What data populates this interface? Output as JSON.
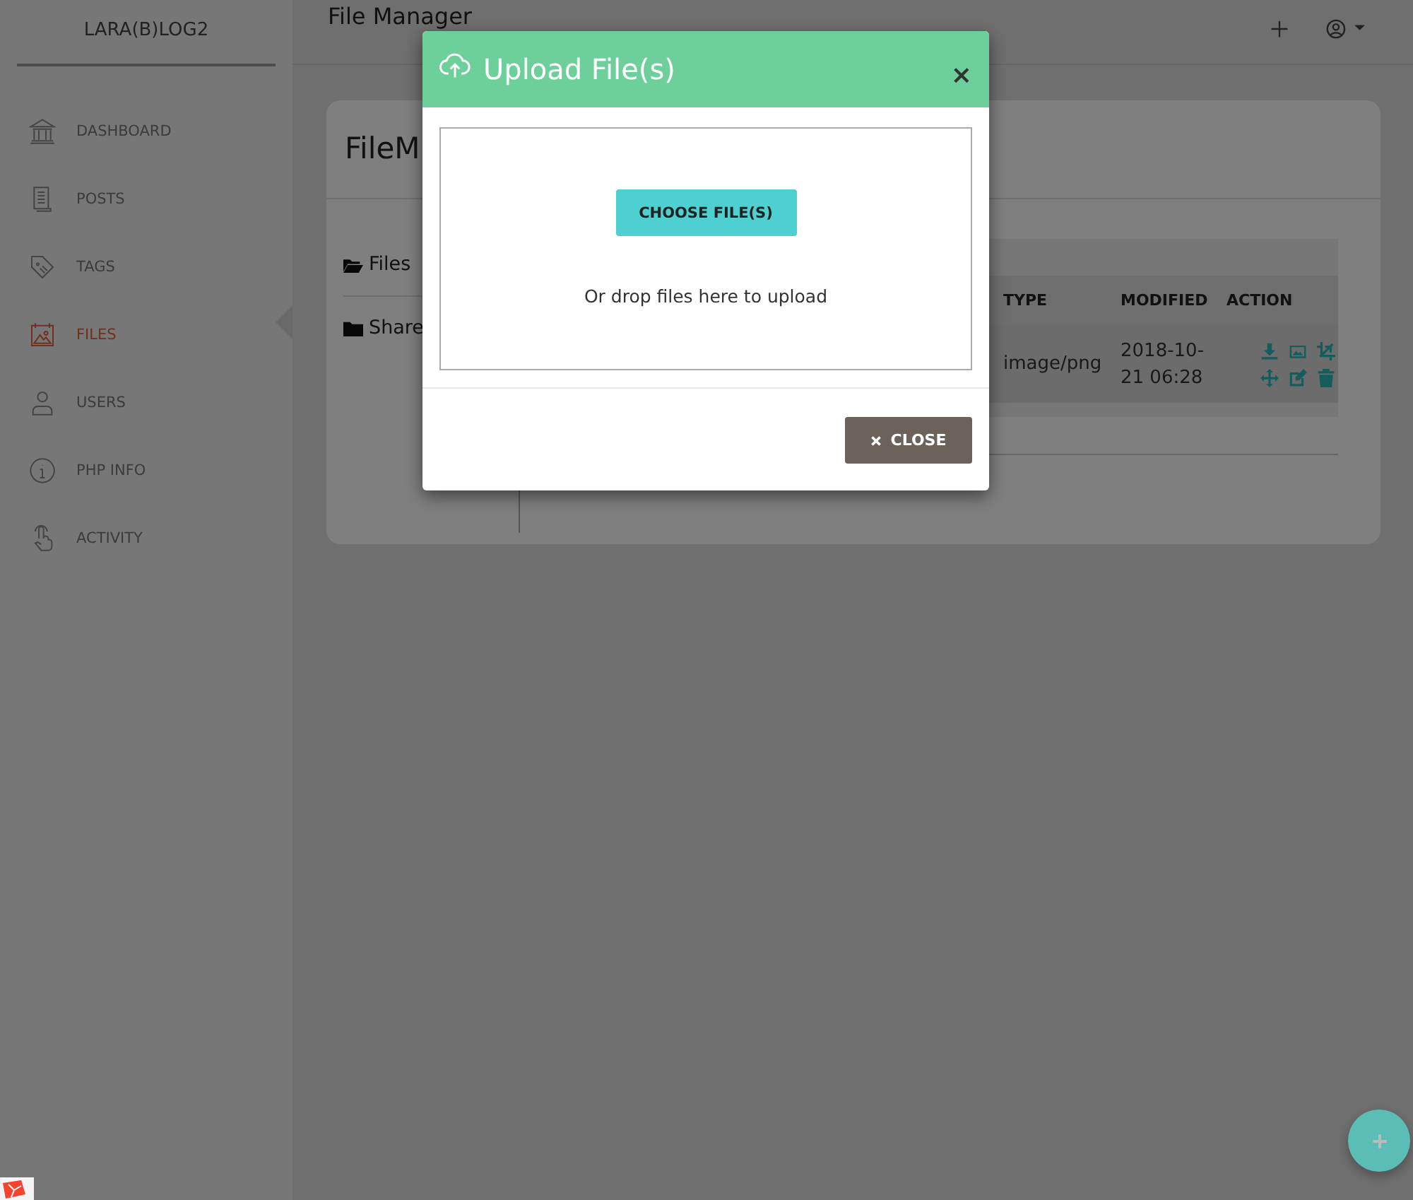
{
  "sidebar": {
    "brand": "LARA(B)LOG2",
    "items": [
      {
        "label": "DASHBOARD",
        "selected": false
      },
      {
        "label": "POSTS",
        "selected": false
      },
      {
        "label": "TAGS",
        "selected": false
      },
      {
        "label": "FILES",
        "selected": true
      },
      {
        "label": "USERS",
        "selected": false
      },
      {
        "label": "PHP INFO",
        "selected": false
      },
      {
        "label": "ACTIVITY",
        "selected": false
      }
    ]
  },
  "header": {
    "title": "File Manager"
  },
  "card": {
    "title": "FileM",
    "folders": [
      {
        "label": "Files",
        "expanded": true
      },
      {
        "label": "Share",
        "expanded": false
      }
    ],
    "table": {
      "columns": [
        "TYPE",
        "MODIFIED",
        "ACTION"
      ],
      "rows": [
        {
          "type": "image/png",
          "modified": "2018-10-21 06:28"
        }
      ]
    }
  },
  "modal": {
    "title": "Upload File(s)",
    "close": "×",
    "choose_button": "CHOOSE FILE(S)",
    "drop_hint": "Or drop files here to upload",
    "close_button": "CLOSE"
  }
}
